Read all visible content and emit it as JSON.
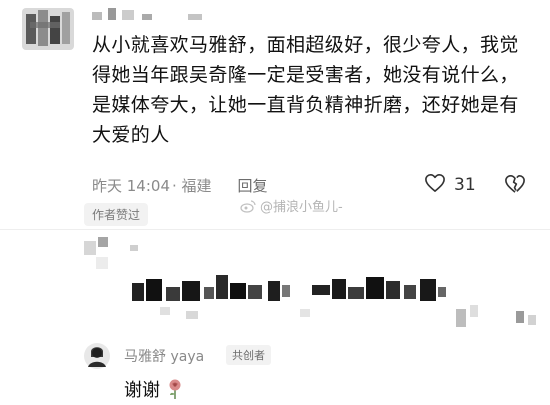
{
  "comment": {
    "text": "从小就喜欢马雅舒，面相超级好，很少夸人，我觉得她当年跟吴奇隆一定是受害者，她没有说什么，是媒体夸大，让她一直背负精神折磨，还好她是有大爱的人",
    "time": "昨天 14:04",
    "location": "· 福建",
    "reply_label": "回复",
    "like_count": "31",
    "author_badge": "作者赞过"
  },
  "watermark": {
    "text": "@捕浪小鱼儿-"
  },
  "reply": {
    "user_name": "马雅舒 yaya",
    "role_badge": "共创者",
    "text": "谢谢"
  },
  "icons": {
    "like": "heart-outline-icon",
    "dislike": "broken-heart-icon",
    "reply_emoji": "rose-icon"
  },
  "colors": {
    "meta_text": "#8a8a8a",
    "badge_bg": "#f2f2f2",
    "body_text": "#111111"
  }
}
